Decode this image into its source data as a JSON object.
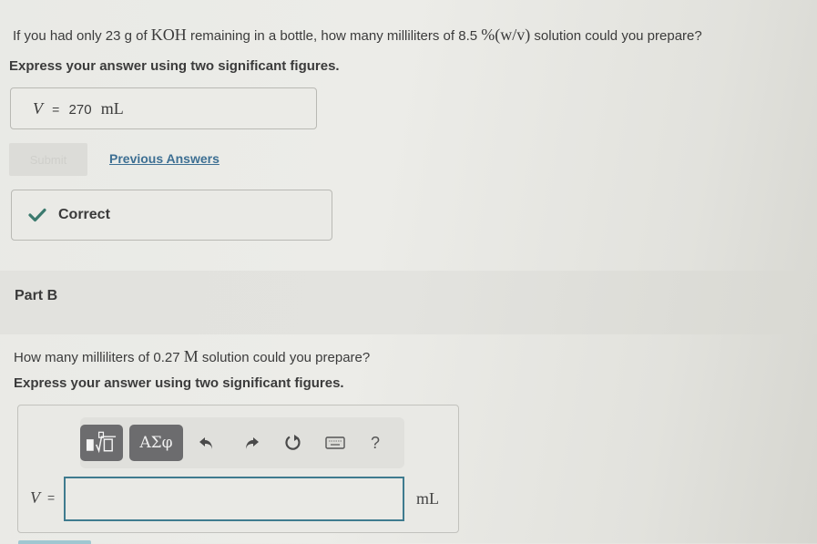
{
  "part_a": {
    "question": {
      "pre": "If you had only 23 g of ",
      "formula": "KOH",
      "mid": " remaining in a bottle, how many milliliters of 8.5 ",
      "concentration_unit": "%(w/v)",
      "post": " solution could you prepare?"
    },
    "instruction": "Express your answer using two significant figures.",
    "submitted_answer": {
      "variable": "V",
      "equals": "=",
      "value": "270",
      "unit": "mL"
    },
    "submit_button": "Submit",
    "previous_answers_link": "Previous Answers",
    "feedback": {
      "status": "Correct",
      "icon": "check-icon",
      "color": "#3b7a6e"
    }
  },
  "part_b": {
    "title": "Part B",
    "question": {
      "pre": "How many milliliters of 0.27 ",
      "unit": "M",
      "post": " solution could you prepare?"
    },
    "instruction": "Express your answer using two significant figures.",
    "toolbar": {
      "buttons": [
        {
          "name": "templates",
          "icon": "fraction-root-template-icon"
        },
        {
          "name": "symbols",
          "label": "ΑΣφ",
          "icon": "greek-symbols-icon"
        },
        {
          "name": "undo",
          "icon": "undo-icon"
        },
        {
          "name": "redo",
          "icon": "redo-icon"
        },
        {
          "name": "reset",
          "icon": "reset-icon"
        },
        {
          "name": "keyboard",
          "icon": "keyboard-icon"
        },
        {
          "name": "help",
          "label": "?",
          "icon": "help-icon"
        }
      ]
    },
    "answer": {
      "variable": "V",
      "equals": "=",
      "value": "",
      "placeholder": "",
      "unit": "mL"
    }
  },
  "colors": {
    "link": "#3d6f93",
    "input_border": "#3f7b8f",
    "toolbar_button": "#6c6c6e",
    "correct_check": "#3b7a6e"
  }
}
